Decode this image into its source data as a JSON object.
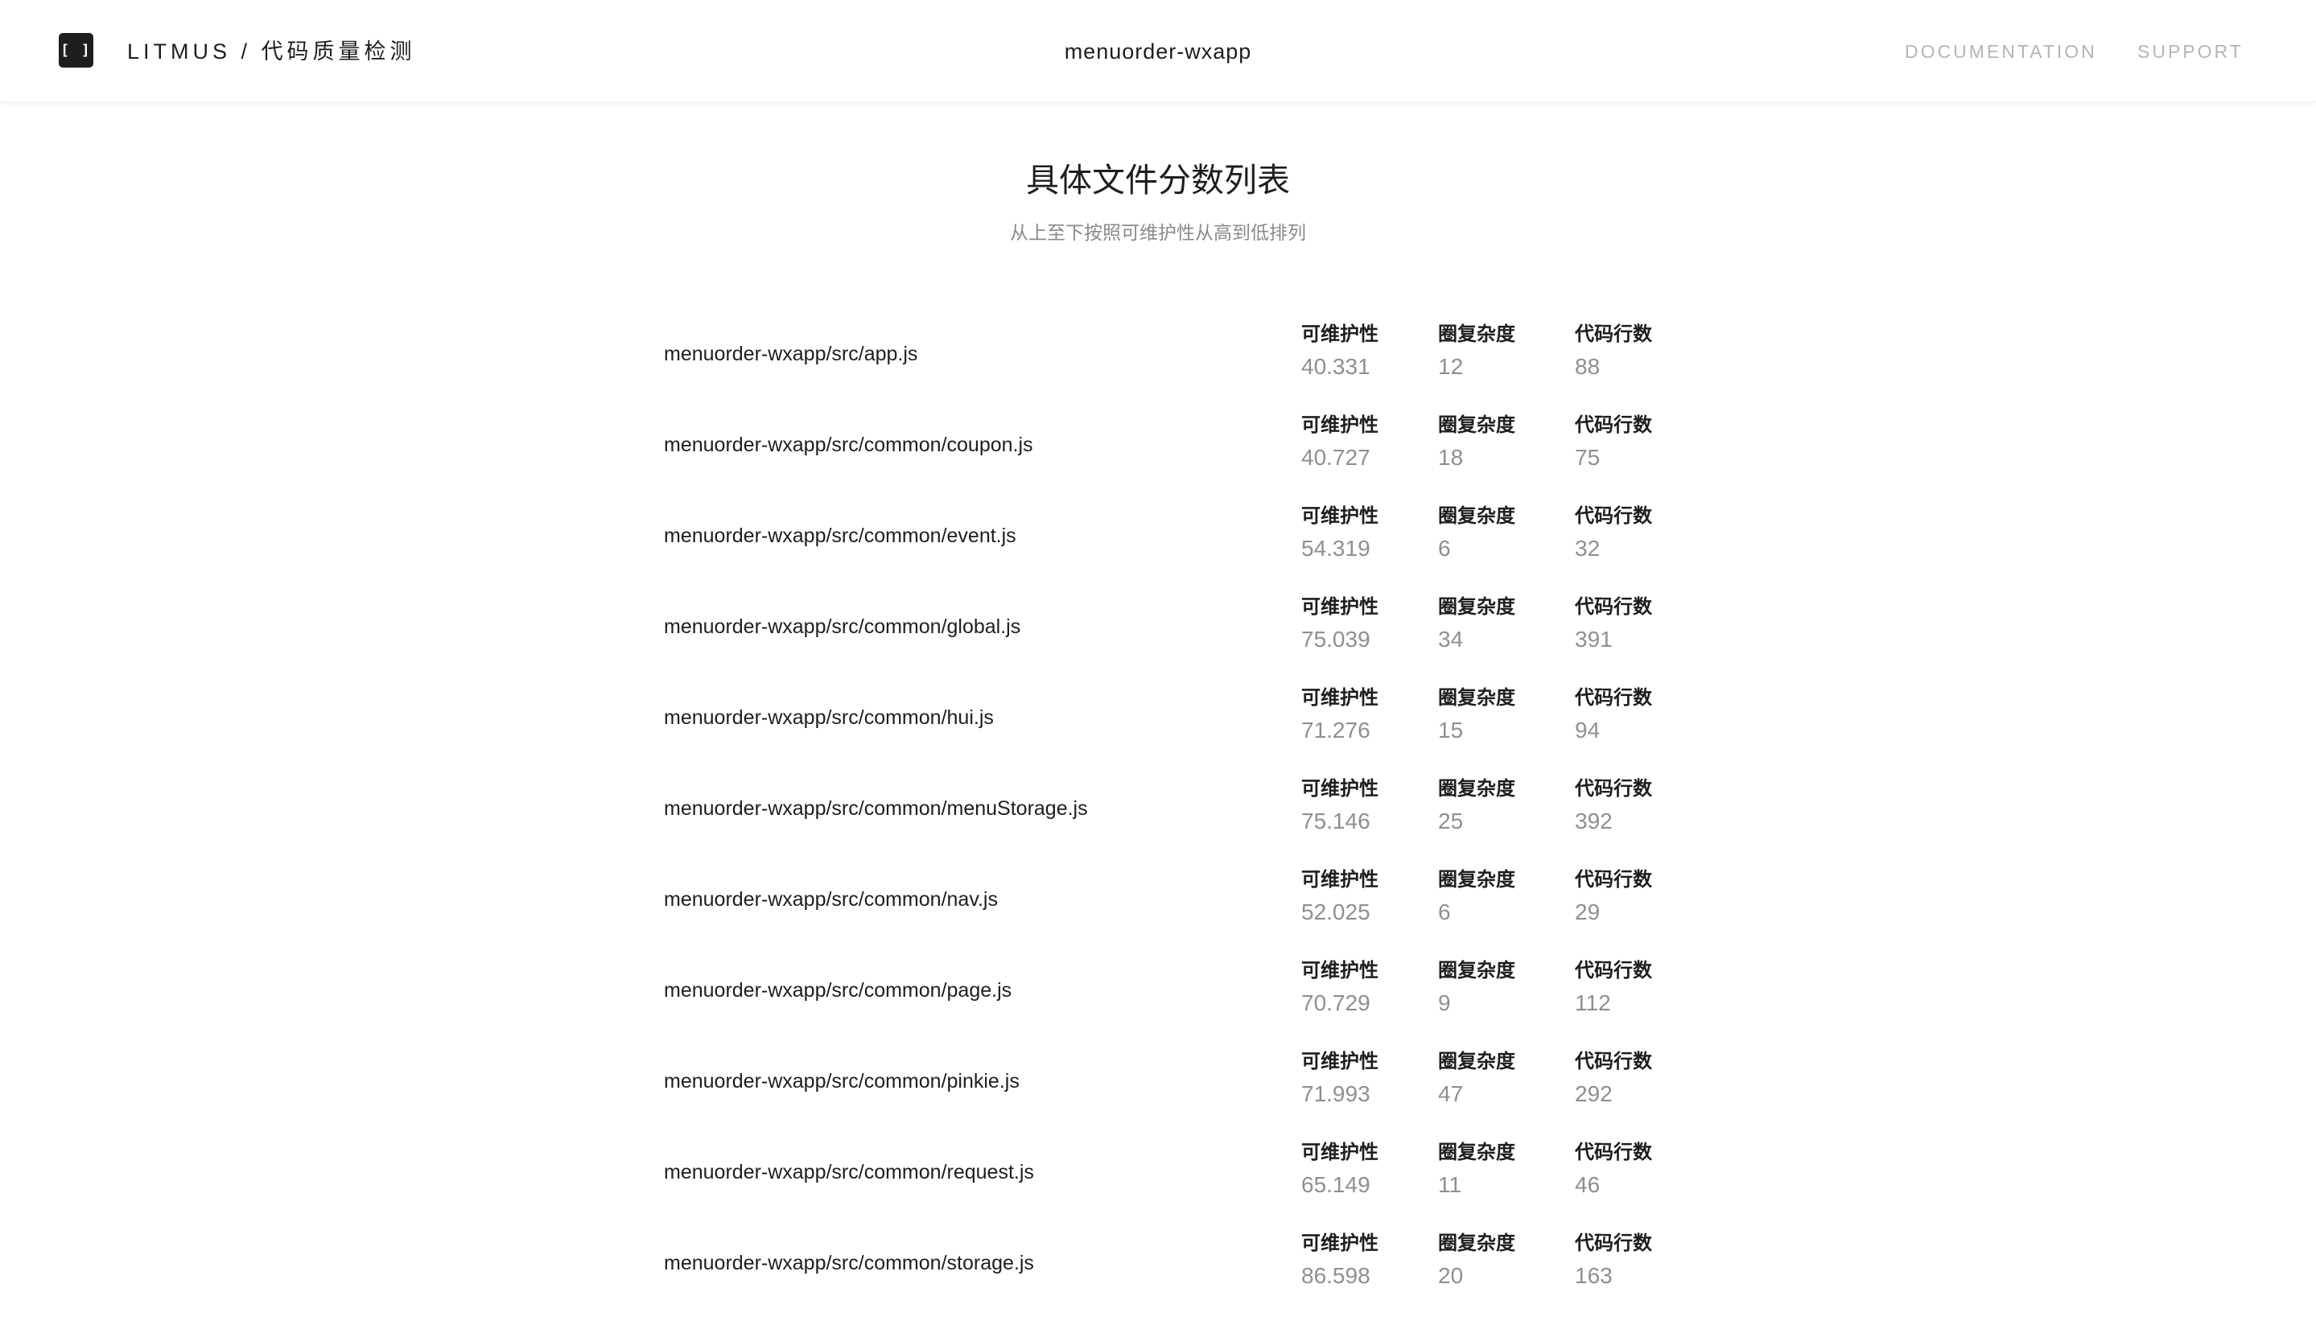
{
  "header": {
    "logo_glyph": "[ ]",
    "brand_name": "LITMUS",
    "brand_separator": "/",
    "brand_subtitle": "代码质量检测",
    "project_name": "menuorder-wxapp",
    "nav": {
      "documentation": "DOCUMENTATION",
      "support": "SUPPORT"
    }
  },
  "main": {
    "title": "具体文件分数列表",
    "subtitle": "从上至下按照可维护性从高到低排列",
    "metric_labels": {
      "maintainability": "可维护性",
      "complexity": "圈复杂度",
      "loc": "代码行数"
    },
    "files": [
      {
        "path": "menuorder-wxapp/src/app.js",
        "maintainability": "40.331",
        "complexity": "12",
        "loc": "88"
      },
      {
        "path": "menuorder-wxapp/src/common/coupon.js",
        "maintainability": "40.727",
        "complexity": "18",
        "loc": "75"
      },
      {
        "path": "menuorder-wxapp/src/common/event.js",
        "maintainability": "54.319",
        "complexity": "6",
        "loc": "32"
      },
      {
        "path": "menuorder-wxapp/src/common/global.js",
        "maintainability": "75.039",
        "complexity": "34",
        "loc": "391"
      },
      {
        "path": "menuorder-wxapp/src/common/hui.js",
        "maintainability": "71.276",
        "complexity": "15",
        "loc": "94"
      },
      {
        "path": "menuorder-wxapp/src/common/menuStorage.js",
        "maintainability": "75.146",
        "complexity": "25",
        "loc": "392"
      },
      {
        "path": "menuorder-wxapp/src/common/nav.js",
        "maintainability": "52.025",
        "complexity": "6",
        "loc": "29"
      },
      {
        "path": "menuorder-wxapp/src/common/page.js",
        "maintainability": "70.729",
        "complexity": "9",
        "loc": "112"
      },
      {
        "path": "menuorder-wxapp/src/common/pinkie.js",
        "maintainability": "71.993",
        "complexity": "47",
        "loc": "292"
      },
      {
        "path": "menuorder-wxapp/src/common/request.js",
        "maintainability": "65.149",
        "complexity": "11",
        "loc": "46"
      },
      {
        "path": "menuorder-wxapp/src/common/storage.js",
        "maintainability": "86.598",
        "complexity": "20",
        "loc": "163"
      }
    ]
  },
  "colors": {
    "text_dark": "#1e1e1e",
    "text_muted": "#8f8f8f",
    "nav_text": "#b5b5b5",
    "logo_bg": "#1e1e1e"
  }
}
